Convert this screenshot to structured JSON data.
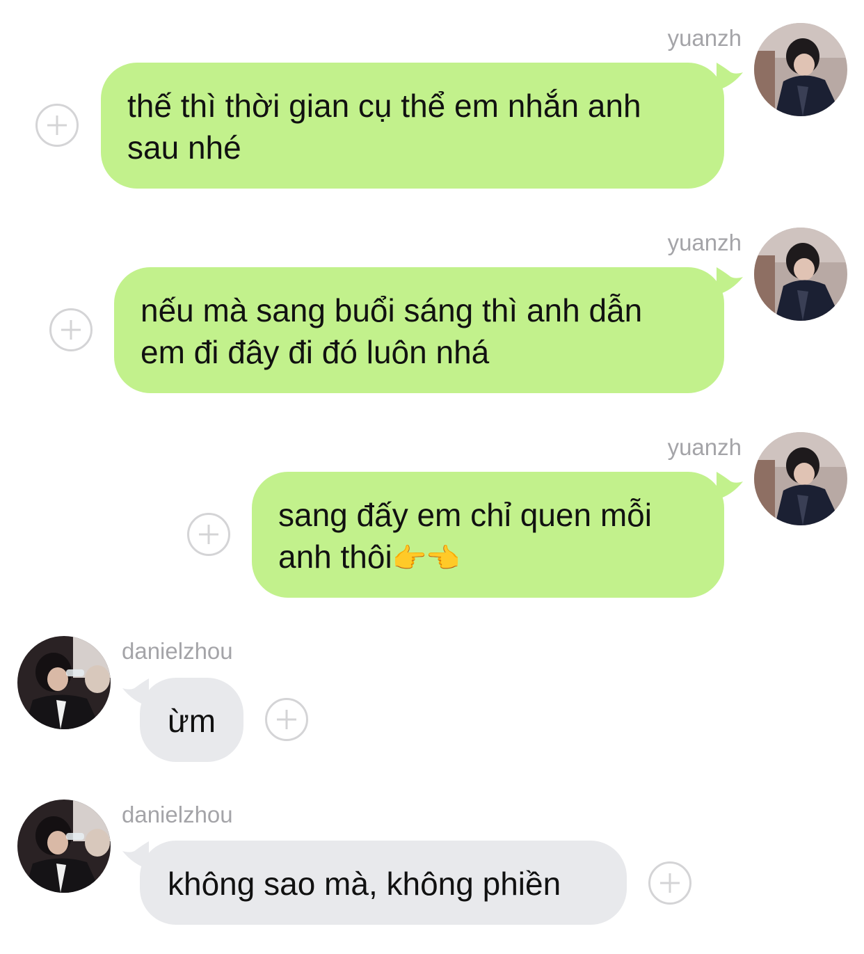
{
  "colors": {
    "sent_bubble": "#c2f18c",
    "received_bubble": "#e8e9ec",
    "username_gray": "#a4a4a8",
    "plus_gray": "#d4d4d6"
  },
  "messages": [
    {
      "sender": "yuanzh",
      "direction": "sent",
      "line1": "thế thì thời gian cụ thể em nhắn anh",
      "line2": "sau nhé",
      "action_icon": "plus-circle-icon"
    },
    {
      "sender": "yuanzh",
      "direction": "sent",
      "line1": "nếu mà sang buổi sáng thì anh dẫn",
      "line2": "em đi đây đi đó luôn nhá",
      "action_icon": "plus-circle-icon"
    },
    {
      "sender": "yuanzh",
      "direction": "sent",
      "line1": "sang đấy em chỉ quen mỗi",
      "line2": "anh thôi",
      "emoji": "👉👈",
      "action_icon": "plus-circle-icon"
    },
    {
      "sender": "danielzhou",
      "direction": "received",
      "line1": "ừm",
      "action_icon": "plus-circle-icon"
    },
    {
      "sender": "danielzhou",
      "direction": "received",
      "line1": "không sao mà, không phiền",
      "action_icon": "plus-circle-icon"
    }
  ]
}
